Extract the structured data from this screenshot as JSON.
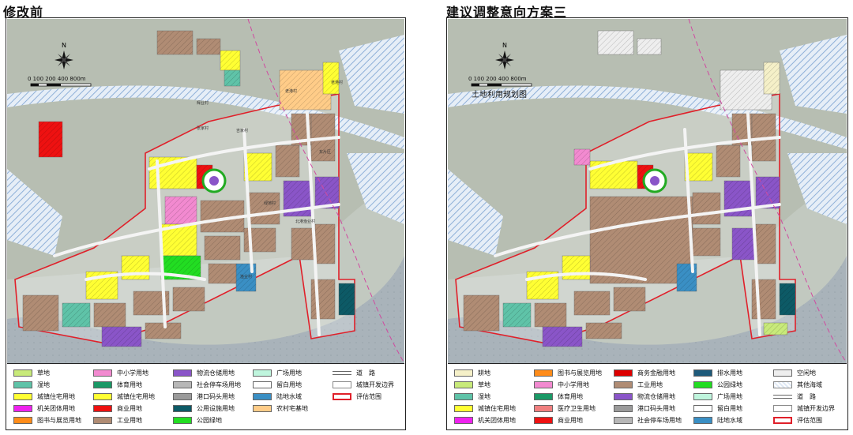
{
  "left": {
    "title": "修改前",
    "scale_label": "0 100 200    400         800m",
    "legend": [
      {
        "label": "草地",
        "color": "#c8ea7a",
        "kind": "fill"
      },
      {
        "label": "湿地",
        "color": "#5fc3a8",
        "kind": "fill"
      },
      {
        "label": "城镇住宅用地",
        "color": "#ffff33",
        "kind": "fill"
      },
      {
        "label": "机关团体用地",
        "color": "#ee22ee",
        "kind": "fill"
      },
      {
        "label": "图书与展览用地",
        "color": "#ff8c1a",
        "kind": "fill"
      },
      {
        "label": "中小学用地",
        "color": "#f28ad0",
        "kind": "fill"
      },
      {
        "label": "体育用地",
        "color": "#1a9966",
        "kind": "fill"
      },
      {
        "label": "城镇住宅用地",
        "color": "#ffff33",
        "kind": "fill"
      },
      {
        "label": "商业用地",
        "color": "#ee1111",
        "kind": "fill"
      },
      {
        "label": "工业用地",
        "color": "#b08c74",
        "kind": "fill"
      },
      {
        "label": "物流仓储用地",
        "color": "#8a55c8",
        "kind": "fill"
      },
      {
        "label": "社会停车场用地",
        "color": "#b7b7b7",
        "kind": "fill"
      },
      {
        "label": "港口码头用地",
        "color": "#9a9a9a",
        "kind": "fill"
      },
      {
        "label": "公用设施用地",
        "color": "#0d5a66",
        "kind": "fill"
      },
      {
        "label": "公园绿地",
        "color": "#22dd22",
        "kind": "fill"
      },
      {
        "label": "广场用地",
        "color": "#bff5dd",
        "kind": "fill"
      },
      {
        "label": "留白用地",
        "color": "#ffffff",
        "kind": "fill"
      },
      {
        "label": "陆地水域",
        "color": "#3a8fc4",
        "kind": "fill"
      },
      {
        "label": "农村宅基地",
        "color": "#ffcc88",
        "kind": "fill"
      },
      {
        "label": "道　路",
        "color": "#ffffff",
        "kind": "line"
      },
      {
        "label": "城镇开发边界",
        "color": "#ffffff",
        "kind": "dev"
      },
      {
        "label": "评估范围",
        "color": "#e0202a",
        "kind": "outline"
      }
    ],
    "place_labels": [
      "老港村",
      "张家村",
      "吉家村",
      "东片区",
      "绿地村",
      "渔业村",
      "北港渔业村",
      "辉业村",
      "老港村"
    ]
  },
  "right": {
    "title": "建议调整意向方案三",
    "scale_label": "0 100 200    400         800m",
    "map_label": "土地利用规划图",
    "legend": [
      {
        "label": "耕地",
        "color": "#f5f0c8",
        "kind": "fill"
      },
      {
        "label": "草地",
        "color": "#c8ea7a",
        "kind": "fill"
      },
      {
        "label": "湿地",
        "color": "#5fc3a8",
        "kind": "fill"
      },
      {
        "label": "城镇住宅用地",
        "color": "#ffff33",
        "kind": "fill"
      },
      {
        "label": "机关团体用地",
        "color": "#ee22ee",
        "kind": "fill"
      },
      {
        "label": "图书与展览用地",
        "color": "#ff8c1a",
        "kind": "fill"
      },
      {
        "label": "中小学用地",
        "color": "#f28ad0",
        "kind": "fill"
      },
      {
        "label": "体育用地",
        "color": "#1a9966",
        "kind": "fill"
      },
      {
        "label": "医疗卫生用地",
        "color": "#f07f7f",
        "kind": "fill"
      },
      {
        "label": "商业用地",
        "color": "#ee1111",
        "kind": "fill"
      },
      {
        "label": "商务金融用地",
        "color": "#dd0000",
        "kind": "fill"
      },
      {
        "label": "工业用地",
        "color": "#b08c74",
        "kind": "fill"
      },
      {
        "label": "物流仓储用地",
        "color": "#8a55c8",
        "kind": "fill"
      },
      {
        "label": "港口码头用地",
        "color": "#9a9a9a",
        "kind": "fill"
      },
      {
        "label": "社会停车场用地",
        "color": "#b7b7b7",
        "kind": "fill"
      },
      {
        "label": "排水用地",
        "color": "#1e5a7a",
        "kind": "fill"
      },
      {
        "label": "公园绿地",
        "color": "#22dd22",
        "kind": "fill"
      },
      {
        "label": "广场用地",
        "color": "#bff5dd",
        "kind": "fill"
      },
      {
        "label": "留白用地",
        "color": "#ffffff",
        "kind": "fill"
      },
      {
        "label": "陆地水域",
        "color": "#3a8fc4",
        "kind": "fill"
      },
      {
        "label": "空闲地",
        "color": "#eeeeee",
        "kind": "fill"
      },
      {
        "label": "其他海域",
        "color": "#dfe9f5",
        "kind": "hatch"
      },
      {
        "label": "道　路",
        "color": "#ffffff",
        "kind": "line"
      },
      {
        "label": "城镇开发边界",
        "color": "#ffffff",
        "kind": "dev"
      },
      {
        "label": "评估范围",
        "color": "#e0202a",
        "kind": "outline"
      }
    ]
  }
}
